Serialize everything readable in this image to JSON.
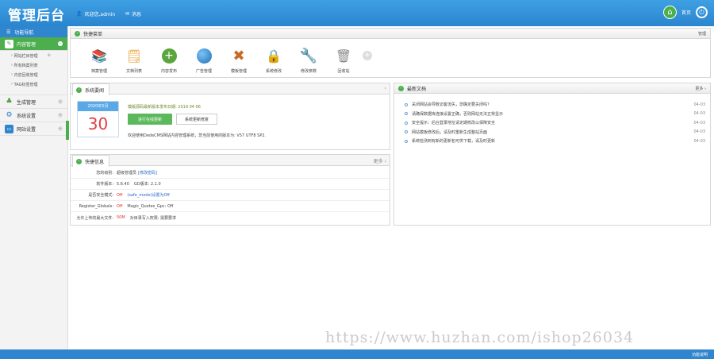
{
  "header": {
    "logo": "管理后台",
    "welcome": "欢迎您,admin",
    "message": "消息",
    "home_label": "首页"
  },
  "sidebar": {
    "title": "功能导航",
    "groups": [
      {
        "label": "内容管理",
        "icon": "document-icon",
        "active": true,
        "items": [
          {
            "label": "网站栏目管理"
          },
          {
            "label": "所有档案列表"
          },
          {
            "label": "内容回收管理"
          },
          {
            "label": "TAG标签管理"
          }
        ]
      },
      {
        "label": "生成管理",
        "icon": "tree-icon"
      },
      {
        "label": "系统设置",
        "icon": "gear-icon"
      },
      {
        "label": "网站设置",
        "icon": "monitor-icon"
      }
    ]
  },
  "shortcuts": {
    "title": "快捷菜单",
    "manage": "管理",
    "items": [
      {
        "label": "档案管理",
        "icon": "books-icon",
        "color": "#8c5a2b"
      },
      {
        "label": "文档列表",
        "icon": "notepad-icon",
        "color": "#e7a43a"
      },
      {
        "label": "内容发布",
        "icon": "add-icon",
        "color": "#5aa53c"
      },
      {
        "label": "广告管理",
        "icon": "globe-icon",
        "color": "#2d8bd6"
      },
      {
        "label": "模板管理",
        "icon": "tools-cross-icon",
        "color": "#c66a22"
      },
      {
        "label": "系统修改",
        "icon": "lock-icon",
        "color": "#e6b20e"
      },
      {
        "label": "修改参数",
        "icon": "wrench-icon",
        "color": "#4a77b0"
      },
      {
        "label": "回收站",
        "icon": "trash-icon",
        "color": "#8a8a8a"
      }
    ]
  },
  "system_info": {
    "tab": "系统要闻",
    "calendar_month": "2020年5月",
    "calendar_day": "30",
    "version_line": "模版源码最新版本发布日期: 2019 04 06",
    "btn_update": "进行在线更新",
    "btn_fix": "系统更新修复",
    "desc": "欢迎使用DedeCMS网站内容管理系统，您当前使用的版本为: V57 UTF8 SP2."
  },
  "latest_docs": {
    "title": "最新文档",
    "more": "更多",
    "items": [
      {
        "title": "关闭网站会导致访客流失，您确定要关闭吗?",
        "date": "04-03"
      },
      {
        "title": "请确保数据库连接设置正确，否则网站无法正常显示",
        "date": "04-03"
      },
      {
        "title": "安全提示：后台登录地址请定期修改以保障安全",
        "date": "04-03"
      },
      {
        "title": "网站模板修改后，请及时重新生成整站页面",
        "date": "04-03"
      },
      {
        "title": "系统检测到有新的更新包可供下载，请及时更新",
        "date": "04-03"
      }
    ]
  },
  "shortcut_stats": {
    "tab": "快捷信息",
    "more": "更多",
    "rows": [
      {
        "label": "您的级别:",
        "value": "超级管理员",
        "link": "[修改密码]"
      },
      {
        "label": "软件版本:",
        "value": "5.6.40",
        "extra": "GD版本: 2.1.0"
      },
      {
        "label": "是否安全模式:",
        "value": "Off",
        "extra": "(safe_mode)设置为Off"
      },
      {
        "label": "Register_Globals:",
        "value": "Off",
        "extra": "Magic_Quotes_Gpc: Off"
      },
      {
        "label": "允许上传的最大文件:",
        "value": "50M",
        "extra": "对目录写入权限: 需要要求"
      }
    ]
  },
  "footer": {
    "right": "功能说明"
  },
  "watermark": "https://www.huzhan.com/ishop26034"
}
